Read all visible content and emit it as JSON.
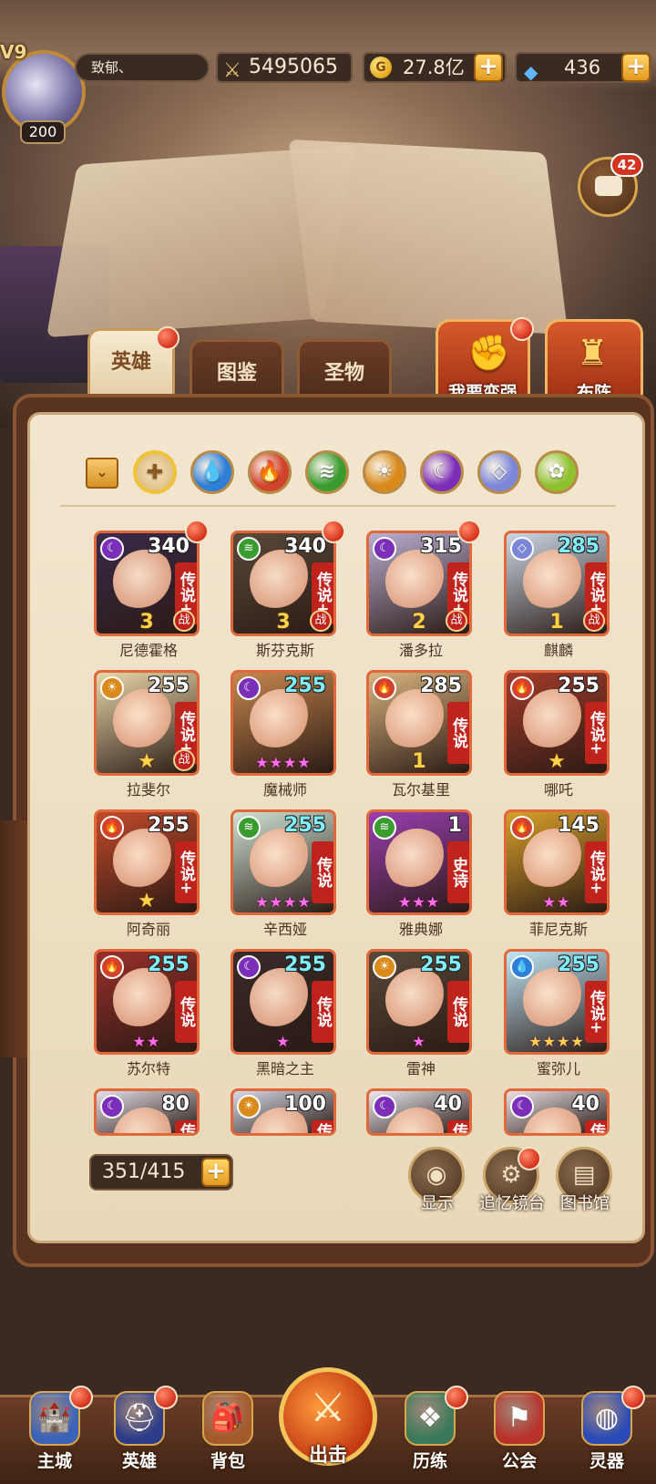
{
  "player": {
    "vip": "V9",
    "level": "200",
    "name": "致郁、",
    "power": "5495065",
    "gold": "27.8亿",
    "gems": "436"
  },
  "chat": {
    "badge": "42"
  },
  "tabs": [
    {
      "label": "英雄",
      "active": true,
      "red_dot": true
    },
    {
      "label": "图鉴",
      "active": false,
      "red_dot": false
    },
    {
      "label": "圣物",
      "active": false,
      "red_dot": false
    }
  ],
  "actions": {
    "strengthen": "我要变强",
    "formation": "布阵"
  },
  "filters": [
    "all",
    "water",
    "fire",
    "wind",
    "light",
    "dark",
    "void",
    "nature"
  ],
  "filter_colors": {
    "all": "#f1d69a",
    "water": "#2f7fd6",
    "fire": "#d1432a",
    "wind": "#3a9b2f",
    "light": "#d98a1b",
    "dark": "#7b2fb8",
    "void": "#7b86d8",
    "nature": "#8fc12f"
  },
  "heroes": [
    {
      "name": "尼德霍格",
      "level": "340",
      "rank": "传说+",
      "element": "dark",
      "stars": "3",
      "war": true,
      "red_dot": true,
      "bg": "#3a2a4a"
    },
    {
      "name": "斯芬克斯",
      "level": "340",
      "rank": "传说+",
      "element": "wind",
      "stars": "3",
      "war": true,
      "red_dot": true,
      "bg": "#5a4a3a"
    },
    {
      "name": "潘多拉",
      "level": "315",
      "rank": "传说+",
      "element": "dark",
      "stars": "2",
      "war": true,
      "red_dot": true,
      "bg": "#b9aed0"
    },
    {
      "name": "麒麟",
      "level": "285",
      "rank": "传说+",
      "element": "void",
      "stars": "1",
      "war": true,
      "red_dot": false,
      "bg": "#cbd7e5",
      "cyan": true
    },
    {
      "name": "拉斐尔",
      "level": "255",
      "rank": "传说+",
      "element": "light",
      "stars": "★",
      "war": true,
      "red_dot": false,
      "bg": "#e9d6a8"
    },
    {
      "name": "魔械师",
      "level": "255",
      "rank": "",
      "element": "dark",
      "stars": "★★★★",
      "war": false,
      "red_dot": false,
      "bg": "#c7874e",
      "cyan": true,
      "pink": true
    },
    {
      "name": "瓦尔基里",
      "level": "285",
      "rank": "传说",
      "element": "fire",
      "stars": "1",
      "war": false,
      "red_dot": false,
      "bg": "#d8b47e"
    },
    {
      "name": "哪吒",
      "level": "255",
      "rank": "传说+",
      "element": "fire",
      "stars": "★",
      "war": false,
      "red_dot": false,
      "bg": "#a33b2b"
    },
    {
      "name": "阿奇丽",
      "level": "255",
      "rank": "传说+",
      "element": "fire",
      "stars": "★",
      "war": false,
      "red_dot": false,
      "bg": "#c24a2a"
    },
    {
      "name": "辛西娅",
      "level": "255",
      "rank": "传说",
      "element": "wind",
      "stars": "★★★★",
      "war": false,
      "red_dot": false,
      "bg": "#cfe3d2",
      "cyan": true,
      "pink": true
    },
    {
      "name": "雅典娜",
      "level": "1",
      "rank": "史诗",
      "element": "wind",
      "stars": "★★★",
      "war": false,
      "red_dot": false,
      "bg": "#9a3fb0",
      "pink": true
    },
    {
      "name": "菲尼克斯",
      "level": "145",
      "rank": "传说+",
      "element": "fire",
      "stars": "★★",
      "war": false,
      "red_dot": false,
      "bg": "#d8a02a",
      "pink": true
    },
    {
      "name": "苏尔特",
      "level": "255",
      "rank": "传说",
      "element": "fire",
      "stars": "★★",
      "war": false,
      "red_dot": false,
      "bg": "#9a2f2a",
      "cyan": true,
      "pink": true
    },
    {
      "name": "黑暗之主",
      "level": "255",
      "rank": "传说",
      "element": "dark",
      "stars": "★",
      "war": false,
      "red_dot": false,
      "bg": "#3a2a2a",
      "cyan": true,
      "pink": true
    },
    {
      "name": "雷神",
      "level": "255",
      "rank": "传说",
      "element": "light",
      "stars": "★",
      "war": false,
      "red_dot": false,
      "bg": "#5a4a3a",
      "cyan": true,
      "pink": true
    },
    {
      "name": "蜜弥儿",
      "level": "255",
      "rank": "传说+",
      "element": "water",
      "stars": "★★★★",
      "war": false,
      "red_dot": false,
      "bg": "#bfe4f5",
      "cyan": true,
      "gold": true
    },
    {
      "name": "",
      "level": "80",
      "rank": "传",
      "element": "dark",
      "stars": "",
      "war": false,
      "red_dot": false,
      "bg": "#e4e0ea"
    },
    {
      "name": "",
      "level": "100",
      "rank": "传",
      "element": "light",
      "stars": "",
      "war": false,
      "red_dot": false,
      "bg": "#d8dbe8"
    },
    {
      "name": "",
      "level": "40",
      "rank": "传",
      "element": "dark",
      "stars": "",
      "war": false,
      "red_dot": false,
      "bg": "#eceaf2"
    },
    {
      "name": "",
      "level": "40",
      "rank": "传",
      "element": "dark",
      "stars": "",
      "war": false,
      "red_dot": false,
      "bg": "#e9e2e6"
    }
  ],
  "footer": {
    "count": "351/415",
    "tools": [
      {
        "label": "显示",
        "red_dot": false
      },
      {
        "label": "追忆镜台",
        "red_dot": true
      },
      {
        "label": "图书馆",
        "red_dot": false
      }
    ]
  },
  "nav": [
    {
      "label": "主城",
      "red_dot": true,
      "color": "#3b63b8"
    },
    {
      "label": "英雄",
      "red_dot": true,
      "color": "#2c3c88"
    },
    {
      "label": "背包",
      "red_dot": false,
      "color": "#a35a2a"
    },
    {
      "label": "出击",
      "red_dot": false,
      "color": "#c33b13"
    },
    {
      "label": "历练",
      "red_dot": true,
      "color": "#3a7a5a"
    },
    {
      "label": "公会",
      "red_dot": false,
      "color": "#b8322a"
    },
    {
      "label": "灵器",
      "red_dot": true,
      "color": "#2a4ab8"
    }
  ]
}
